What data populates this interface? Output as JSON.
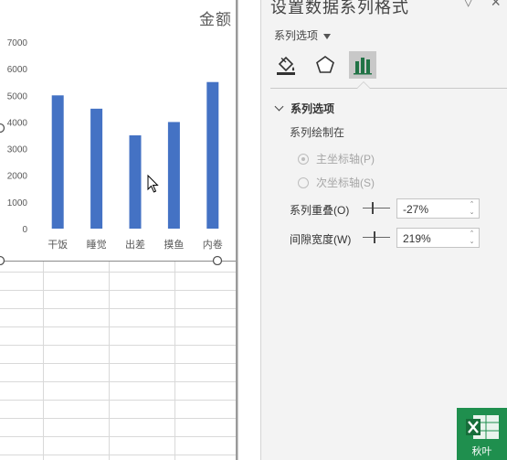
{
  "chart_data": {
    "type": "bar",
    "title": "金额",
    "categories": [
      "干饭",
      "睡觉",
      "出差",
      "摸鱼",
      "内卷"
    ],
    "series": [
      {
        "values": [
          5000,
          4500,
          3500,
          4000,
          5500
        ]
      }
    ],
    "y_ticks": [
      0,
      1000,
      2000,
      3000,
      4000,
      5000,
      6000,
      7000
    ],
    "ylim": [
      0,
      7000
    ],
    "bar_color": "#4472c4",
    "grid": false,
    "legend": "none"
  },
  "pane": {
    "title": "设置数据系列格式",
    "series_selector": "系列选项",
    "section": "系列选项",
    "plot_on_label": "系列绘制在",
    "primary_axis": "主坐标轴(P)",
    "secondary_axis": "次坐标轴(S)",
    "overlap_label": "系列重叠(O)",
    "overlap_value": "-27%",
    "gap_label": "间隙宽度(W)",
    "gap_value": "219%",
    "selected_tab": "series-options",
    "selected_axis": "primary"
  },
  "watermark": {
    "text": "秋叶",
    "color": "#1f8f4e"
  },
  "icons": [
    "fill-bucket-icon",
    "pentagon-icon",
    "bar-chart-icon",
    "chevron-down-icon",
    "close-icon",
    "excel-icon"
  ]
}
